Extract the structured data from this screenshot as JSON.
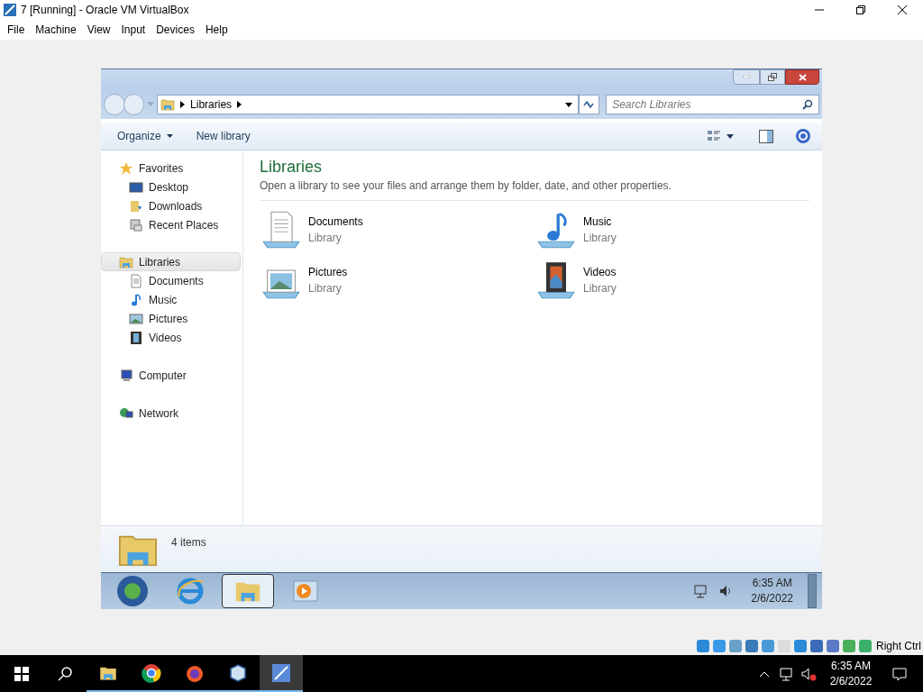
{
  "host_window": {
    "title": "7 [Running] - Oracle VM VirtualBox",
    "menu": [
      "File",
      "Machine",
      "View",
      "Input",
      "Devices",
      "Help"
    ]
  },
  "explorer": {
    "address": [
      "Libraries"
    ],
    "search": {
      "placeholder": "Search Libraries"
    },
    "toolbar": [
      "Organize",
      "New library"
    ],
    "nav": [
      {
        "label": "Favorites",
        "selected": false,
        "children": [
          {
            "label": "Desktop",
            "selected": false
          },
          {
            "label": "Downloads",
            "selected": false
          },
          {
            "label": "Recent Places",
            "selected": false
          }
        ]
      },
      {
        "label": "Libraries",
        "selected": true,
        "children": [
          {
            "label": "Documents",
            "selected": false
          },
          {
            "label": "Music",
            "selected": false
          },
          {
            "label": "Pictures",
            "selected": false
          },
          {
            "label": "Videos",
            "selected": false
          }
        ]
      },
      {
        "label": "Computer",
        "selected": false
      },
      {
        "label": "Network",
        "selected": false
      }
    ],
    "heading": "Libraries",
    "description": "Open a library to see your files and arrange them by folder, date, and other properties.",
    "libraries": [
      {
        "name": "Documents",
        "type": "Library"
      },
      {
        "name": "Music",
        "type": "Library"
      },
      {
        "name": "Pictures",
        "type": "Library"
      },
      {
        "name": "Videos",
        "type": "Library"
      }
    ],
    "status": "4 items"
  },
  "guest_taskbar": {
    "apps": [
      {
        "selected": false
      },
      {
        "selected": false
      },
      {
        "selected": true
      },
      {
        "selected": false
      }
    ],
    "time": "6:35 AM",
    "date": "2/6/2022"
  },
  "vbox_status": {
    "host_key": "Right Ctrl"
  },
  "host_taskbar": {
    "apps": [
      {
        "selected": false
      },
      {
        "selected": false
      },
      {
        "selected": false
      },
      {
        "selected": false
      },
      {
        "selected": true
      }
    ],
    "time": "6:35 AM",
    "date": "2/6/2022"
  }
}
